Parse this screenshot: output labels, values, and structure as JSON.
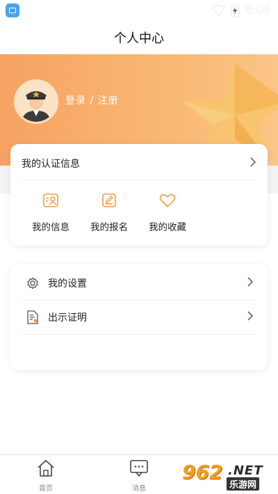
{
  "status_bar": {
    "time": "6:06"
  },
  "header": {
    "title": "个人中心"
  },
  "profile": {
    "login_text": "登录 / 注册"
  },
  "auth_card": {
    "title": "我的认证信息",
    "quick_items": [
      {
        "label": "我的信息",
        "icon": "id-card-icon"
      },
      {
        "label": "我的报名",
        "icon": "edit-icon"
      },
      {
        "label": "我的收藏",
        "icon": "heart-icon"
      }
    ]
  },
  "menu": [
    {
      "label": "我的设置",
      "icon": "gear-icon"
    },
    {
      "label": "出示证明",
      "icon": "document-icon"
    }
  ],
  "tabbar": [
    {
      "label": "首页",
      "icon": "home-icon"
    },
    {
      "label": "消息",
      "icon": "message-icon"
    }
  ],
  "watermark": {
    "number": "962",
    "suffix": ".NET",
    "subtitle": "乐游网"
  },
  "colors": {
    "accent": "#f6a263",
    "icon_orange": "#e8a040"
  }
}
